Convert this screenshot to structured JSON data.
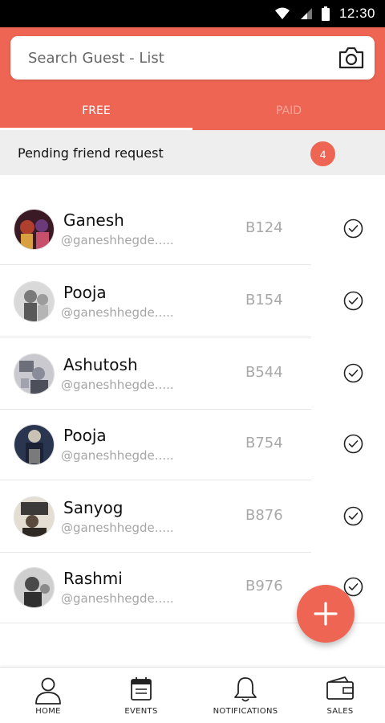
{
  "status_bar": {
    "time": "12:30"
  },
  "search": {
    "placeholder": "Search Guest - List"
  },
  "tabs": [
    {
      "label": "FREE",
      "active": true
    },
    {
      "label": "PAID",
      "active": false
    }
  ],
  "pending": {
    "label": "Pending friend request",
    "count": "4"
  },
  "guests": [
    {
      "name": "Ganesh",
      "handle": "@ganeshhegde.....",
      "code": "B124",
      "checked": true
    },
    {
      "name": "Pooja",
      "handle": "@ganeshhegde.....",
      "code": "B154",
      "checked": true
    },
    {
      "name": "Ashutosh",
      "handle": "@ganeshhegde.....",
      "code": "B544",
      "checked": true
    },
    {
      "name": "Pooja",
      "handle": "@ganeshhegde.....",
      "code": "B754",
      "checked": true
    },
    {
      "name": "Sanyog",
      "handle": "@ganeshhegde.....",
      "code": "B876",
      "checked": true
    },
    {
      "name": "Rashmi",
      "handle": "@ganeshhegde.....",
      "code": "B976",
      "checked": true
    }
  ],
  "fab": {
    "icon": "plus-icon"
  },
  "bottom_nav": [
    {
      "label": "HOME",
      "icon": "user-icon"
    },
    {
      "label": "EVENTS",
      "icon": "calendar-icon"
    },
    {
      "label": "NOTIFICATIONS",
      "icon": "bell-icon"
    },
    {
      "label": "SALES",
      "icon": "wallet-icon"
    }
  ],
  "colors": {
    "accent": "#ee6553",
    "tab_inactive": "#f4a59a",
    "pending_bg": "#eeeeee"
  }
}
